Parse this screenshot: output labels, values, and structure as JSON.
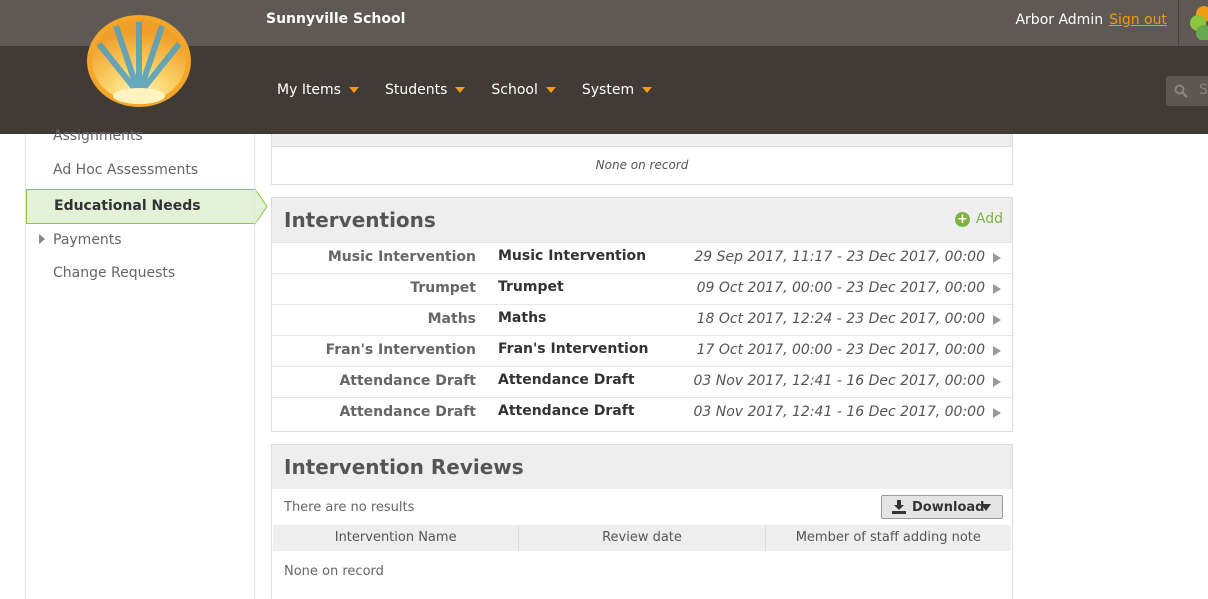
{
  "topbar": {
    "school_name": "Sunnyville School",
    "user_name": "Arbor Admin",
    "sign_out": "Sign out"
  },
  "nav": {
    "items": [
      {
        "label": "My Items"
      },
      {
        "label": "Students"
      },
      {
        "label": "School"
      },
      {
        "label": "System"
      }
    ],
    "search_placeholder": "S"
  },
  "sidebar": {
    "items": [
      {
        "label": "Assignments"
      },
      {
        "label": "Ad Hoc Assessments"
      },
      {
        "label": "Educational Needs",
        "active": true
      },
      {
        "label": "Payments",
        "expandable": true
      },
      {
        "label": "Change Requests"
      }
    ]
  },
  "top_panel": {
    "empty_text": "None on record"
  },
  "interventions": {
    "title": "Interventions",
    "add_label": "Add",
    "rows": [
      {
        "name": "Music Intervention",
        "title": "Music Intervention",
        "dates": "29 Sep 2017, 11:17 - 23 Dec 2017, 00:00"
      },
      {
        "name": "Trumpet",
        "title": "Trumpet",
        "dates": "09 Oct 2017, 00:00 - 23 Dec 2017, 00:00"
      },
      {
        "name": "Maths",
        "title": "Maths",
        "dates": "18 Oct 2017, 12:24 - 23 Dec 2017, 00:00"
      },
      {
        "name": "Fran's Intervention",
        "title": "Fran's Intervention",
        "dates": "17 Oct 2017, 00:00 - 23 Dec 2017, 00:00"
      },
      {
        "name": "Attendance Draft",
        "title": "Attendance Draft",
        "dates": "03 Nov 2017, 12:41 - 16 Dec 2017, 00:00"
      },
      {
        "name": "Attendance Draft",
        "title": "Attendance Draft",
        "dates": "03 Nov 2017, 12:41 - 16 Dec 2017, 00:00"
      }
    ]
  },
  "reviews": {
    "title": "Intervention Reviews",
    "no_results": "There are no results",
    "download_label": "Download",
    "columns": [
      "Intervention Name",
      "Review date",
      "Member of staff adding note"
    ],
    "empty_text": "None on record"
  },
  "colors": {
    "topbar": "#5e5952",
    "navbar": "#403b35",
    "accent_orange": "#f39c12",
    "accent_green": "#7cb342",
    "active_bg": "#e2f1d7"
  }
}
